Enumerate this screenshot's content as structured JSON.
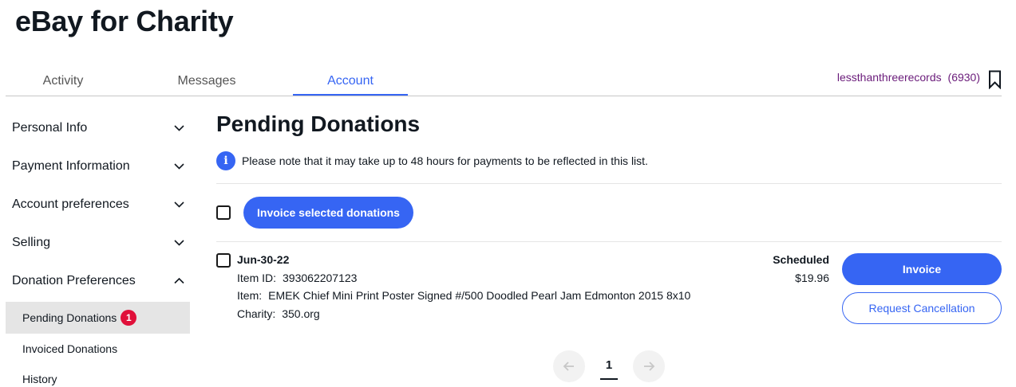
{
  "header": {
    "title": "eBay for Charity"
  },
  "tabs": [
    {
      "label": "Activity"
    },
    {
      "label": "Messages"
    },
    {
      "label": "Account"
    }
  ],
  "user": {
    "name": "lessthanthreerecords",
    "feedback": "(6930)"
  },
  "sidebar": {
    "items": [
      {
        "label": "Personal Info"
      },
      {
        "label": "Payment Information"
      },
      {
        "label": "Account preferences"
      },
      {
        "label": "Selling"
      },
      {
        "label": "Donation Preferences"
      }
    ],
    "subitems": [
      {
        "label": "Pending Donations",
        "badge": "1"
      },
      {
        "label": "Invoiced Donations"
      },
      {
        "label": "History"
      }
    ]
  },
  "main": {
    "title": "Pending Donations",
    "notice": "Please note that it may take up to 48 hours for payments to be reflected in this list.",
    "invoice_selected_label": "Invoice selected donations",
    "donation": {
      "date": "Jun-30-22",
      "item_id_label": "Item ID:",
      "item_id": "393062207123",
      "item_label": "Item:",
      "item": "EMEK Chief Mini Print Poster Signed #/500 Doodled Pearl Jam Edmonton 2015 8x10",
      "charity_label": "Charity:",
      "charity": "350.org",
      "status": "Scheduled",
      "amount": "$19.96",
      "invoice_label": "Invoice",
      "cancel_label": "Request Cancellation"
    },
    "pagination": {
      "current": "1"
    }
  },
  "colors": {
    "accent": "#3665f3",
    "badge": "#e0103a",
    "username": "#6a1b7a"
  }
}
